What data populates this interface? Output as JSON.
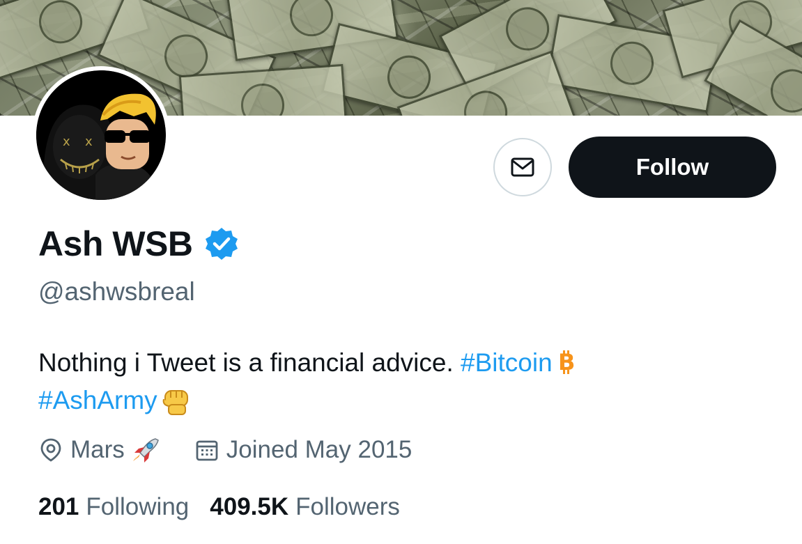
{
  "profile": {
    "follow_label": "Follow",
    "name": "Ash WSB",
    "handle": "@ashwsbreal",
    "bio": {
      "text": "Nothing i Tweet is a financial advice. ",
      "hashtag1": "#Bitcoin",
      "emoji1": "bitcoin-emoji",
      "hashtag2": "#AshArmy",
      "emoji2": "raised-fist-emoji"
    },
    "location": "Mars",
    "location_emoji": "rocket-emoji",
    "joined": "Joined May 2015",
    "following_count": "201",
    "following_label": "Following",
    "followers_count": "409.5K",
    "followers_label": "Followers"
  },
  "icons": {
    "message": "envelope-icon",
    "verified": "verified-badge-icon",
    "location": "location-pin-icon",
    "calendar": "calendar-icon"
  },
  "colors": {
    "accent": "#1d9bf0",
    "text": "#0f1419",
    "secondary": "#536471",
    "follow_bg": "#0f1419"
  }
}
